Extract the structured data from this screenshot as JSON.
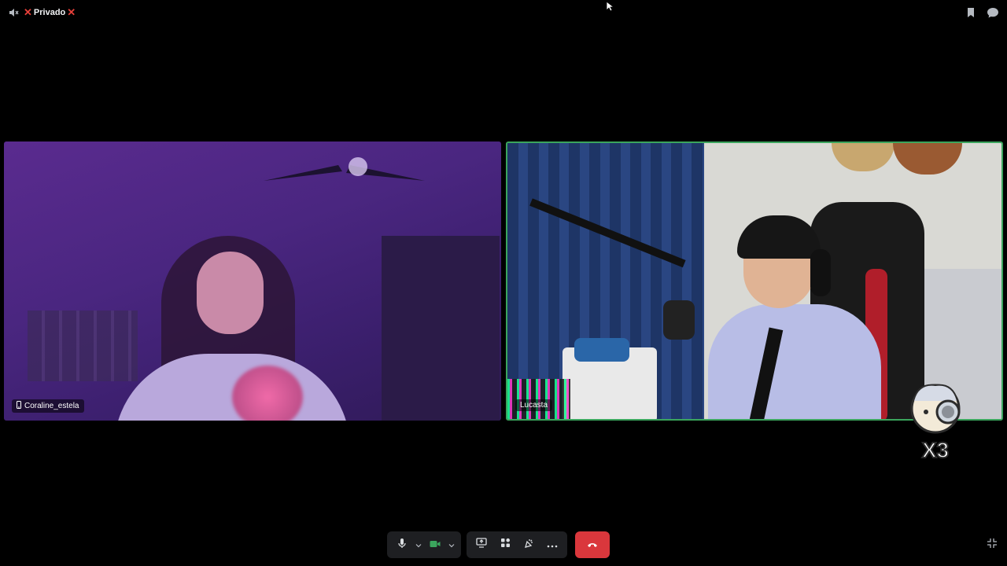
{
  "header": {
    "channel_name": "Privado",
    "prefix_mark": "❌",
    "suffix_mark": "❌",
    "left_icon": "speaker-muted-icon",
    "right_icons": [
      "bookmark-icon",
      "chat-bubble-icon"
    ]
  },
  "participants": [
    {
      "name": "Coraline_estela",
      "device_icon": "mobile-phone-icon",
      "speaking": false
    },
    {
      "name": "Lucasta",
      "speaking": true
    }
  ],
  "overlay": {
    "sticker_text": "X3",
    "sticker_icon": "cartoon-mascot-icon"
  },
  "controls": {
    "microphone": "microphone-icon",
    "camera": "camera-icon",
    "screen_share": "screen-share-icon",
    "activities": "activities-icon",
    "soundboard": "soundboard-icon",
    "more": "more-options-icon",
    "hangup": "hang-up-icon",
    "fullscreen": "exit-fullscreen-icon"
  },
  "colors": {
    "speaking_border": "#3ba55d",
    "hangup": "#da373c",
    "camera_on": "#3ba55d",
    "control_bg": "#1e1f22",
    "x_mark": "#e8403a"
  }
}
